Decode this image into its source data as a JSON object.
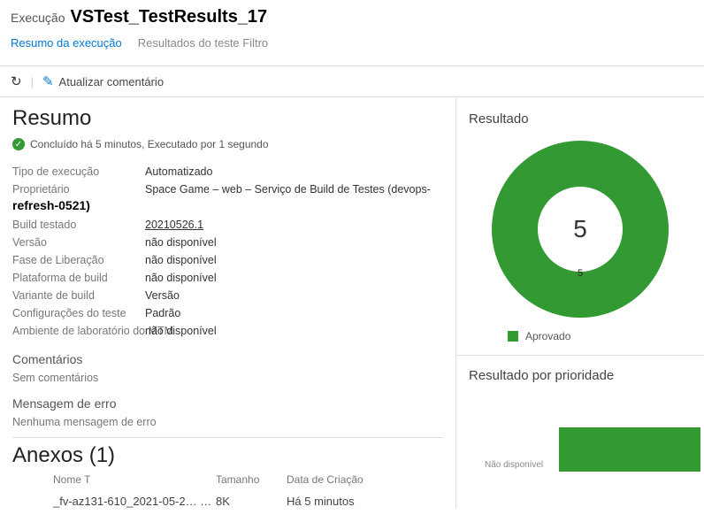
{
  "header": {
    "prefix": "Execução",
    "run_name": "VSTest_TestResults_17"
  },
  "tabs": {
    "summary": "Resumo da execução",
    "results": "Resultados do teste Filtro"
  },
  "toolbar": {
    "refresh_icon": "↻",
    "edit_icon": "✎",
    "update_label": "Atualizar comentário"
  },
  "summary": {
    "title": "Resumo",
    "status_text": "Concluído há 5 minutos, Executado por 1 segundo"
  },
  "owner_line2": "refresh-0521)",
  "fields": {
    "run_type_label": "Tipo de execução",
    "run_type_value": "Automatizado",
    "owner_label": "Proprietário",
    "owner_value": "Space Game – web – Serviço de Build de Testes (devops-",
    "tested_build_label": "Build testado",
    "tested_build_value": "20210526.1",
    "release_label": "Versão",
    "release_value": "não disponível",
    "release_phase_label": "Fase de Liberação",
    "release_phase_value": "não disponível",
    "build_platform_label": "Plataforma de build",
    "build_platform_value": "não disponível",
    "build_flavor_label": "Variante de build",
    "build_flavor_value": "Versão",
    "test_config_label": "Configurações do teste",
    "test_config_value": "Padrão",
    "lab_env_label": "Ambiente de laboratório do MTM",
    "lab_env_value": "não disponível"
  },
  "comments": {
    "title": "Comentários",
    "empty": "Sem comentários"
  },
  "error": {
    "title": "Mensagem de erro",
    "empty": "Nenhuma mensagem de erro"
  },
  "attachments": {
    "title": "Anexos (1)",
    "col_name": "Nome T",
    "col_size": "Tamanho",
    "col_date": "Data de Criação",
    "row_name": "_fv-az131-610_2021-05-2… …",
    "row_size": "8K",
    "row_date": "Há 5 minutos"
  },
  "chart_data": {
    "type": "pie",
    "title": "Resultado",
    "center_value": "5",
    "slices": [
      {
        "label": "Aprovado",
        "value": 5,
        "color": "#339933"
      }
    ],
    "slice_bottom_label": "5",
    "legend_position": "bottom"
  },
  "priority_chart": {
    "title": "Resultado por prioridade",
    "y_tick": "Não disponível",
    "type": "bar",
    "bars": [
      {
        "value": 5,
        "color": "#339933"
      }
    ]
  }
}
